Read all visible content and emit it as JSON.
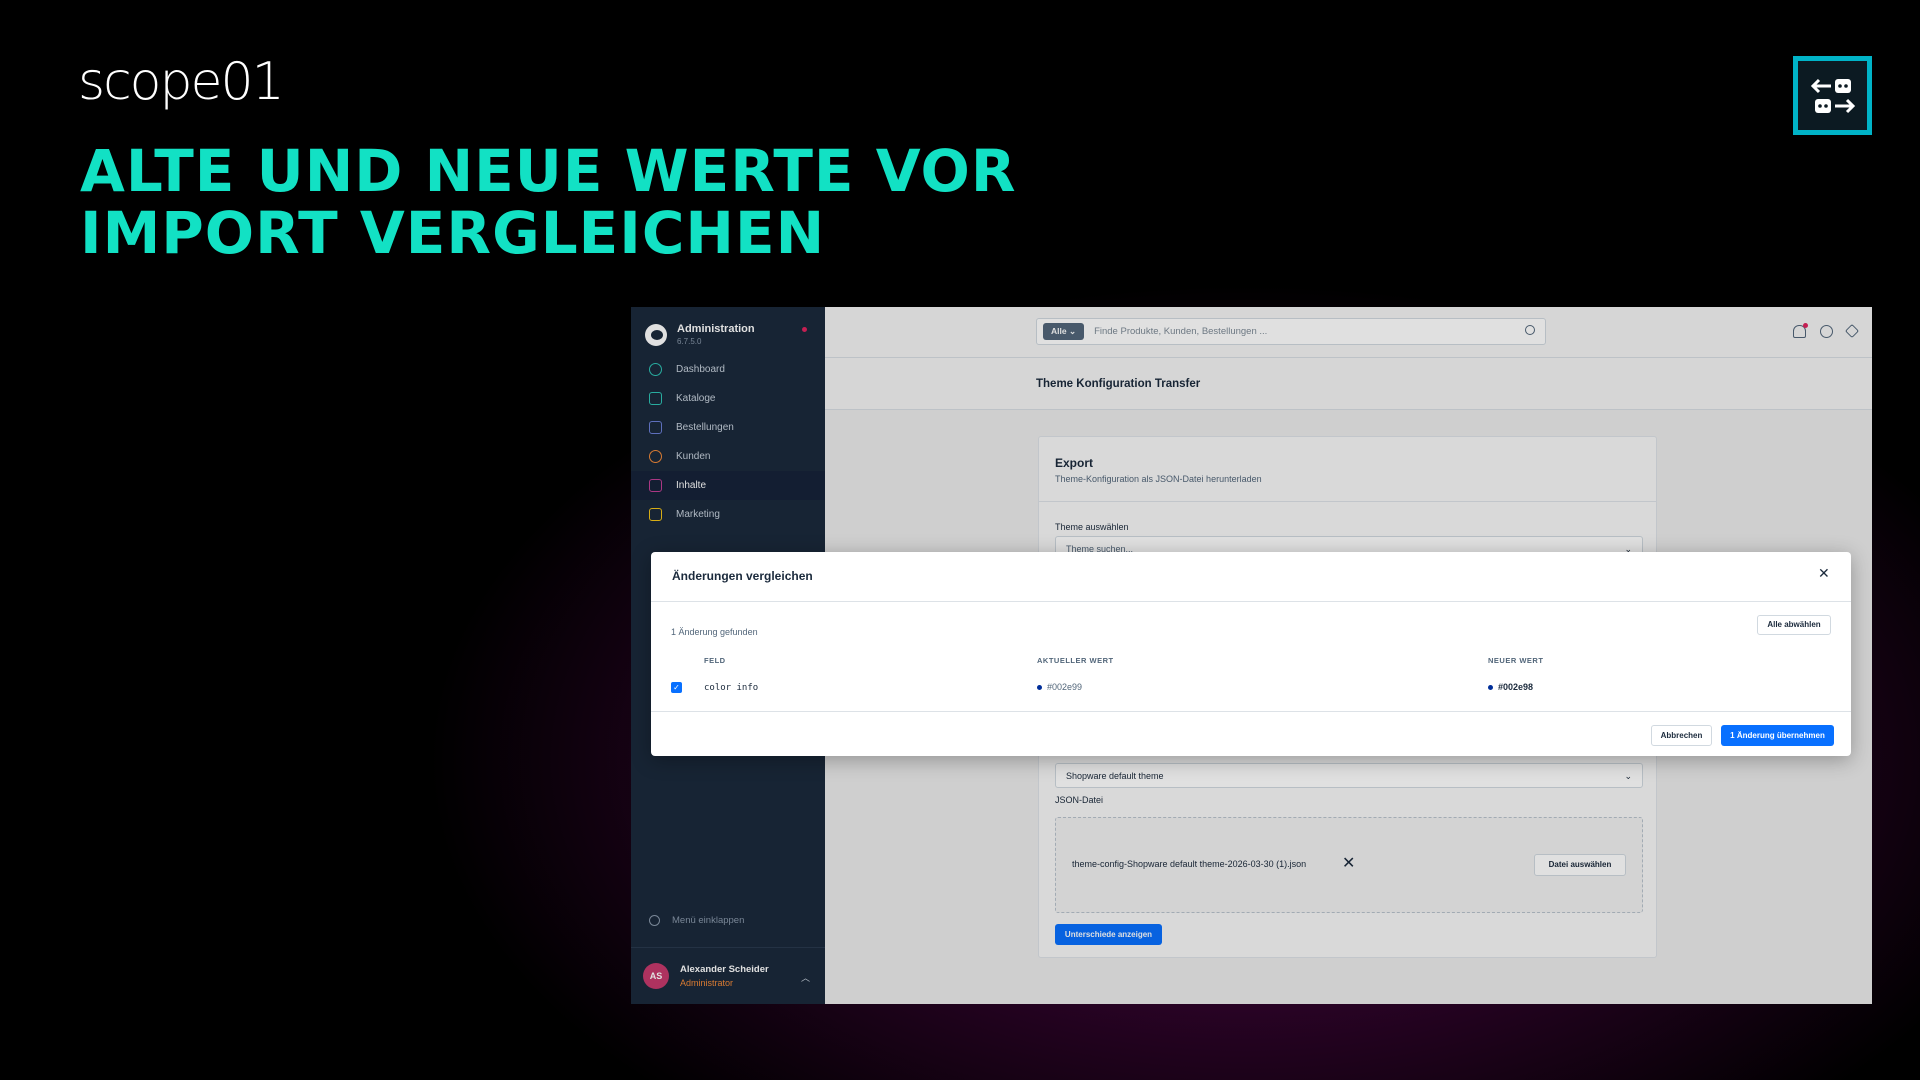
{
  "brand": {
    "logo_text": "scope01"
  },
  "headline": {
    "line1": "ALTE UND NEUE WERTE VOR",
    "line2": "IMPORT VERGLEICHEN"
  },
  "corner_icon": {
    "name": "transfer-arrows-icon",
    "color": "#00b3c7"
  },
  "admin": {
    "sidebar": {
      "title": "Administration",
      "version": "6.7.5.0",
      "items": [
        {
          "label": "Dashboard",
          "icon": "dashboard-icon",
          "color": "#2ec4b6"
        },
        {
          "label": "Kataloge",
          "icon": "catalog-icon",
          "color": "#2ec4b6"
        },
        {
          "label": "Bestellungen",
          "icon": "orders-icon",
          "color": "#6b7fd7"
        },
        {
          "label": "Kunden",
          "icon": "customers-icon",
          "color": "#f58b39"
        },
        {
          "label": "Inhalte",
          "icon": "content-icon",
          "color": "#c23f97"
        },
        {
          "label": "Marketing",
          "icon": "marketing-icon",
          "color": "#f5c518"
        }
      ],
      "collapse_label": "Menü einklappen",
      "user": {
        "initials": "AS",
        "name": "Alexander Scheider",
        "role": "Administrator"
      }
    },
    "topbar": {
      "search_scope": "Alle",
      "search_placeholder": "Finde Produkte, Kunden, Bestellungen ..."
    },
    "page_title": "Theme Konfiguration Transfer",
    "export_card": {
      "title": "Export",
      "subtitle": "Theme-Konfiguration als JSON-Datei herunterladen",
      "theme_label": "Theme auswählen",
      "theme_placeholder": "Theme suchen...",
      "import_theme_value": "Shopware default theme",
      "json_label": "JSON-Datei",
      "file_name": "theme-config-Shopware default theme-2026-03-30 (1).json",
      "file_button": "Datei auswählen",
      "diff_button": "Unterschiede anzeigen"
    },
    "modal": {
      "title": "Änderungen vergleichen",
      "found_text": "1 Änderung gefunden",
      "deselect_all": "Alle abwählen",
      "columns": {
        "field": "FELD",
        "current": "AKTUELLER WERT",
        "new": "NEUER WERT"
      },
      "rows": [
        {
          "checked": true,
          "field": "color info",
          "current": "#002e99",
          "new": "#002e98"
        }
      ],
      "cancel": "Abbrechen",
      "apply": "1 Änderung übernehmen"
    }
  }
}
